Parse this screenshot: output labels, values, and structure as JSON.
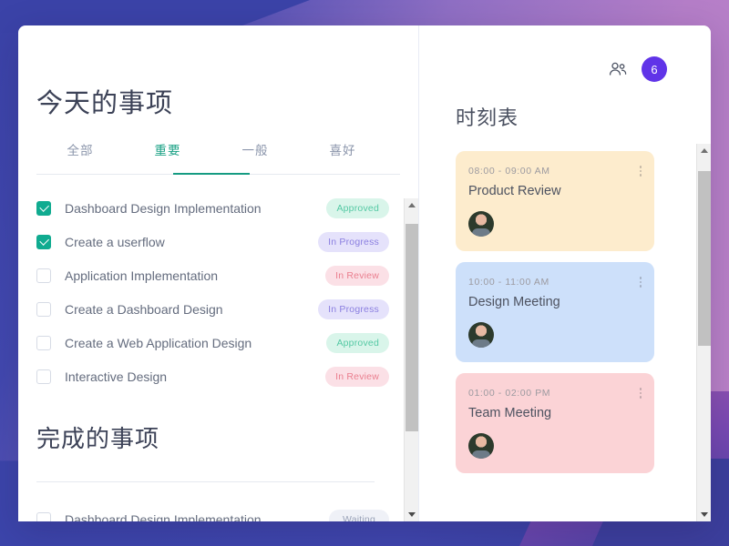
{
  "window": {
    "left_panel": {
      "title": "今天的事项",
      "tabs": [
        {
          "label": "全部",
          "active": false
        },
        {
          "label": "重要",
          "active": true
        },
        {
          "label": "一般",
          "active": false
        },
        {
          "label": "喜好",
          "active": false
        }
      ],
      "tasks": [
        {
          "label": "Dashboard Design Implementation",
          "checked": true,
          "badge": "Approved",
          "badge_type": "approved"
        },
        {
          "label": "Create a userflow",
          "checked": true,
          "badge": "In Progress",
          "badge_type": "progress"
        },
        {
          "label": "Application Implementation",
          "checked": false,
          "badge": "In Review",
          "badge_type": "review"
        },
        {
          "label": "Create a Dashboard Design",
          "checked": false,
          "badge": "In Progress",
          "badge_type": "progress"
        },
        {
          "label": "Create a Web Application Design",
          "checked": false,
          "badge": "Approved",
          "badge_type": "approved"
        },
        {
          "label": "Interactive Design",
          "checked": false,
          "badge": "In Review",
          "badge_type": "review"
        }
      ],
      "completed_title": "完成的事项",
      "completed_tasks": [
        {
          "label": "Dashboard Design Implementation",
          "checked": false,
          "badge": "Waiting",
          "badge_type": "waiting"
        }
      ]
    },
    "right_panel": {
      "people_icon": "people-group-icon",
      "count": "6",
      "title": "时刻表",
      "schedule": [
        {
          "time": "08:00 - 09:00 AM",
          "title": "Product Review",
          "color": "cream",
          "hex": "#fdeccd"
        },
        {
          "time": "10:00 - 11:00 AM",
          "title": "Design Meeting",
          "color": "blue",
          "hex": "#cde0fa"
        },
        {
          "time": "01:00 - 02:00 PM",
          "title": "Team Meeting",
          "color": "pink",
          "hex": "#fbd3d6"
        }
      ]
    }
  },
  "colors": {
    "accent_teal": "#10ab90",
    "badge_purple": "#6034e8",
    "background_indigo": "#3b43a8",
    "background_mauve": "#bd84c9"
  }
}
